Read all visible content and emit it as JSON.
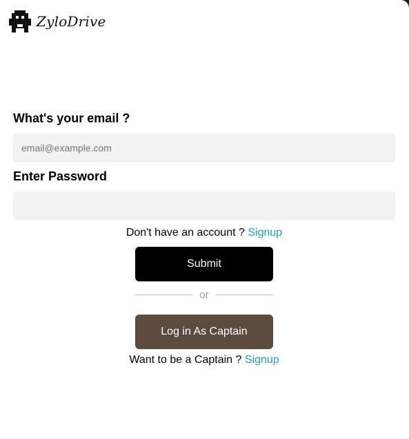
{
  "brand": {
    "name": "ZyloDrive",
    "icon": "robot-logo-icon"
  },
  "form": {
    "email_label": "What's your email ?",
    "email_placeholder": "email@example.com",
    "email_value": "",
    "password_label": "Enter Password",
    "password_value": "",
    "signup_prompt": "Don't have an account ? ",
    "signup_link": "Signup",
    "submit_label": "Submit",
    "divider_text": "or",
    "captain_login_label": "Log in As Captain",
    "captain_prompt": "Want to be a Captain ? ",
    "captain_signup_link": "Signup"
  },
  "colors": {
    "primary_button": "#000000",
    "captain_button": "#5c4a3e",
    "link": "#25a0a0",
    "input_bg": "#f2f2f2"
  }
}
